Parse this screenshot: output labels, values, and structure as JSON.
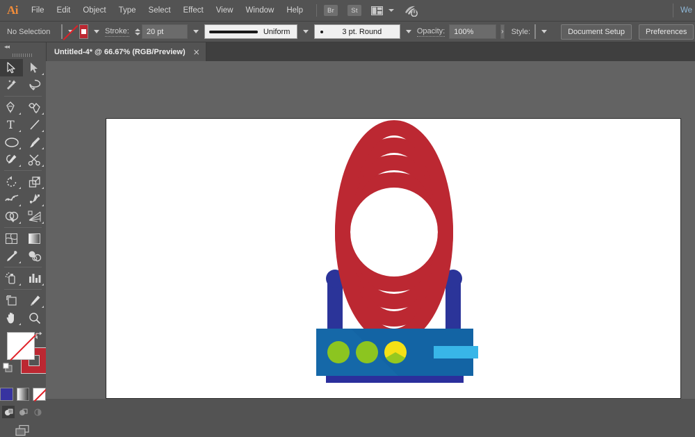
{
  "app": {
    "name": "Adobe Illustrator",
    "logo_text": "Ai"
  },
  "menubar": {
    "items": [
      {
        "label": "File"
      },
      {
        "label": "Edit"
      },
      {
        "label": "Object"
      },
      {
        "label": "Type"
      },
      {
        "label": "Select"
      },
      {
        "label": "Effect"
      },
      {
        "label": "View"
      },
      {
        "label": "Window"
      },
      {
        "label": "Help"
      }
    ],
    "bridge_chip": "Br",
    "stock_chip": "St",
    "arrange_icon": "arrange-documents-icon",
    "cc_icon": "cc-sync-icon",
    "workspace_label": "We"
  },
  "controlbar": {
    "selection_status": "No Selection",
    "fill_label": "fill-swatch-none",
    "stroke_swatch_label": "stroke-swatch-red",
    "stroke_label": "Stroke:",
    "stroke_weight": "20 pt",
    "stroke_profile": "Uniform",
    "brush_definition": "3 pt. Round",
    "opacity_label": "Opacity:",
    "opacity_value": "100%",
    "opacity_more": "›",
    "style_label": "Style:",
    "document_setup": "Document Setup",
    "preferences": "Preferences",
    "align_icon": "align-to-icon"
  },
  "tabbar": {
    "document_tab": "Untitled-4* @ 66.67% (RGB/Preview)",
    "close_glyph": "×"
  },
  "toolbar": {
    "collapse_glyph": "◂◂",
    "tools": [
      {
        "name": "selection-tool",
        "active": true,
        "sub": false
      },
      {
        "name": "direct-selection-tool",
        "active": false,
        "sub": true
      },
      {
        "name": "magic-wand-tool",
        "active": false,
        "sub": false
      },
      {
        "name": "lasso-tool",
        "active": false,
        "sub": false
      },
      {
        "name": "pen-tool",
        "active": false,
        "sub": true
      },
      {
        "name": "curvature-tool",
        "active": false,
        "sub": true
      },
      {
        "name": "type-tool",
        "active": false,
        "sub": true
      },
      {
        "name": "line-segment-tool",
        "active": false,
        "sub": true
      },
      {
        "name": "ellipse-tool",
        "active": false,
        "sub": true
      },
      {
        "name": "paintbrush-tool",
        "active": false,
        "sub": true
      },
      {
        "name": "shaper-pencil-tool",
        "active": false,
        "sub": true
      },
      {
        "name": "scissors-eraser-tool",
        "active": false,
        "sub": true
      },
      {
        "name": "rotate-tool",
        "active": false,
        "sub": true
      },
      {
        "name": "scale-tool",
        "active": false,
        "sub": true
      },
      {
        "name": "width-warp-tool",
        "active": false,
        "sub": true
      },
      {
        "name": "free-transform-tool",
        "active": false,
        "sub": true
      },
      {
        "name": "shape-builder-tool",
        "active": false,
        "sub": true
      },
      {
        "name": "perspective-grid-tool",
        "active": false,
        "sub": true
      },
      {
        "name": "mesh-tool",
        "active": false,
        "sub": false
      },
      {
        "name": "gradient-tool",
        "active": false,
        "sub": false
      },
      {
        "name": "eyedropper-tool",
        "active": false,
        "sub": true
      },
      {
        "name": "blend-tool",
        "active": false,
        "sub": false
      },
      {
        "name": "symbol-sprayer-tool",
        "active": false,
        "sub": true
      },
      {
        "name": "column-graph-tool",
        "active": false,
        "sub": true
      },
      {
        "name": "artboard-tool",
        "active": false,
        "sub": false
      },
      {
        "name": "slice-tool",
        "active": false,
        "sub": true
      },
      {
        "name": "hand-tool",
        "active": false,
        "sub": true
      },
      {
        "name": "zoom-tool",
        "active": false,
        "sub": false
      }
    ],
    "fill_swatch": "none",
    "stroke_swatch_color": "#bc2832",
    "swap_icon": "swap-fill-stroke-icon",
    "default_icon": "default-fill-stroke-icon",
    "color_mode_swatch": "#3733a0",
    "gradient_mode": "gradient-swatch",
    "none_mode": "none-swatch",
    "draw_modes": [
      "draw-normal",
      "draw-behind",
      "draw-inside"
    ],
    "screen_mode": "change-screen-mode-icon"
  },
  "artwork": {
    "title": "wifi-router-illustration",
    "colors": {
      "wave_red": "#bc2832",
      "body_blue": "#1568a8",
      "body_blue_shade": "#1560a0",
      "antenna_indigo": "#2b3499",
      "base_indigo": "#2b2f9c",
      "led_green": "#8cc520",
      "led_yellow": "#f5e016",
      "port_light_blue": "#38b6e8"
    },
    "leds": [
      "green",
      "green",
      "yellow"
    ]
  }
}
